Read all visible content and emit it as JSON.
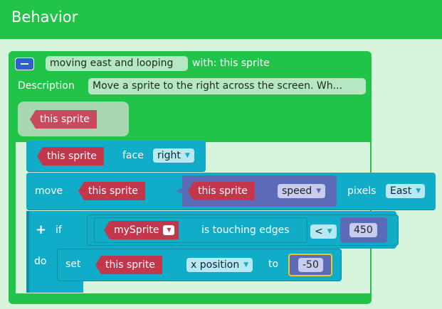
{
  "header": {
    "title": "Behavior"
  },
  "function": {
    "name": "moving east and looping",
    "with_label": "with: this sprite",
    "description_label": "Description",
    "description": "Move a sprite to the right across the screen. Wh...",
    "param": "this sprite"
  },
  "blocks": {
    "face": {
      "sprite": "this sprite",
      "label": "face",
      "direction": "right"
    },
    "move": {
      "label": "move",
      "sprite": "this sprite",
      "getter_sprite": "this sprite",
      "property": "speed",
      "pixels_label": "pixels",
      "direction": "East"
    },
    "if": {
      "label": "if",
      "do_label": "do",
      "sprite": "mySprite",
      "touch_label": "is touching edges",
      "operator": "<",
      "value": "450"
    },
    "set": {
      "label": "set",
      "sprite": "this sprite",
      "property": "x position",
      "to_label": "to",
      "value": "-50"
    }
  },
  "colors": {
    "header": "#21c449",
    "function_block": "#21c449",
    "statement_block": "#11acc8",
    "sprite_reporter": "#c2374b",
    "math_block": "#5c6bb8",
    "selection_outline": "#f5c518"
  }
}
